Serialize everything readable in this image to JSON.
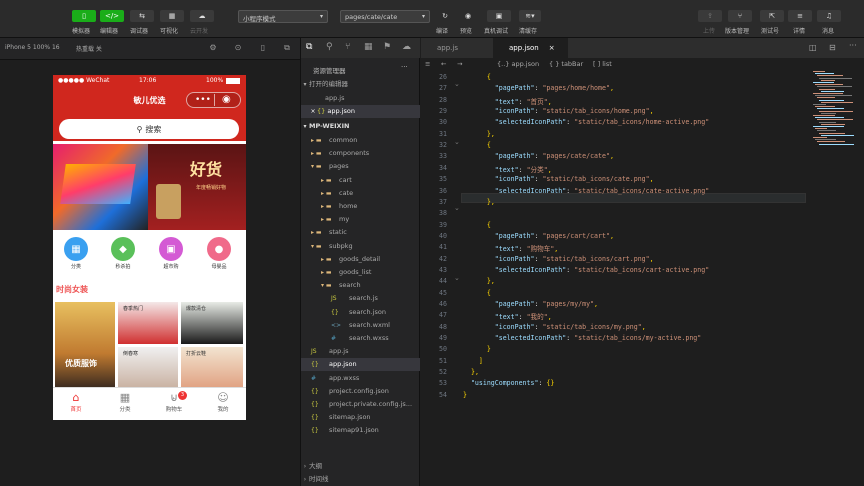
{
  "toolbar": {
    "left_buttons": [
      "模拟器",
      "编辑器",
      "调试器",
      "可视化",
      "云开发"
    ],
    "mode_select": "小程序模式",
    "page_select": "pages/cate/cate",
    "mid_buttons": [
      "编译",
      "预览",
      "真机调试",
      "清缓存"
    ],
    "right_buttons": [
      "上传",
      "版本管理",
      "测试号",
      "详情",
      "消息"
    ]
  },
  "simbar": {
    "device": "iPhone 5 100% 16",
    "hotreload": "热重载 关"
  },
  "phone": {
    "carrier": "●●●●● WeChat",
    "time": "17:06",
    "battery": "100%",
    "title": "敏儿优选",
    "search": "搜索",
    "banner_text": "好货",
    "banner_sub": "年度畅销好物",
    "cats": [
      "分类",
      "秒杀拍",
      "超市购",
      "母婴品"
    ],
    "floor_title": "时尚女装",
    "floor_tag1": "优质服饰",
    "floor_tag2": "春季热门",
    "floor_tag3": "爆款清仓",
    "floor_tag4": "倒春寒",
    "floor_tag5": "打折云鞋",
    "tabs": [
      "首页",
      "分类",
      "购物车",
      "我的"
    ],
    "cart_badge": "3"
  },
  "explorer": {
    "header": "资源管理器",
    "open_editors": "打开的编辑器",
    "open_files": [
      "app.js",
      "app.json"
    ],
    "project": "MP-WEIXIN",
    "tree": [
      {
        "name": "common",
        "depth": 1,
        "type": "folder"
      },
      {
        "name": "components",
        "depth": 1,
        "type": "folder"
      },
      {
        "name": "pages",
        "depth": 1,
        "type": "folder-open"
      },
      {
        "name": "cart",
        "depth": 2,
        "type": "folder"
      },
      {
        "name": "cate",
        "depth": 2,
        "type": "folder"
      },
      {
        "name": "home",
        "depth": 2,
        "type": "folder"
      },
      {
        "name": "my",
        "depth": 2,
        "type": "folder"
      },
      {
        "name": "static",
        "depth": 1,
        "type": "folder"
      },
      {
        "name": "subpkg",
        "depth": 1,
        "type": "folder-open"
      },
      {
        "name": "goods_detail",
        "depth": 2,
        "type": "folder"
      },
      {
        "name": "goods_list",
        "depth": 2,
        "type": "folder"
      },
      {
        "name": "search",
        "depth": 2,
        "type": "folder-open"
      },
      {
        "name": "search.js",
        "depth": 3,
        "type": "js"
      },
      {
        "name": "search.json",
        "depth": 3,
        "type": "json"
      },
      {
        "name": "search.wxml",
        "depth": 3,
        "type": "wxml"
      },
      {
        "name": "search.wxss",
        "depth": 3,
        "type": "wxss"
      },
      {
        "name": "app.js",
        "depth": 1,
        "type": "js"
      },
      {
        "name": "app.json",
        "depth": 1,
        "type": "json"
      },
      {
        "name": "app.wxss",
        "depth": 1,
        "type": "wxss"
      },
      {
        "name": "project.config.json",
        "depth": 1,
        "type": "json"
      },
      {
        "name": "project.private.config.js...",
        "depth": 1,
        "type": "json"
      },
      {
        "name": "sitemap.json",
        "depth": 1,
        "type": "json"
      },
      {
        "name": "sitemap91.json",
        "depth": 1,
        "type": "json"
      }
    ],
    "outline": "大纲",
    "timeline": "时间线"
  },
  "editor": {
    "tabs": [
      "app.js",
      "app.json"
    ],
    "breadcrumb": [
      "{..} app.json",
      "{ } tabBar",
      "[ ] list"
    ],
    "lines": [
      {
        "n": "26",
        "t": "      {"
      },
      {
        "n": "27",
        "t": "        \"pagePath\": \"pages/home/home\","
      },
      {
        "n": "28",
        "t": "        \"text\": \"首页\","
      },
      {
        "n": "29",
        "t": "        \"iconPath\": \"static/tab_icons/home.png\","
      },
      {
        "n": "30",
        "t": "        \"selectedIconPath\": \"static/tab_icons/home-active.png\""
      },
      {
        "n": "31",
        "t": "      },"
      },
      {
        "n": "32",
        "t": "      {"
      },
      {
        "n": "33",
        "t": "        \"pagePath\": \"pages/cate/cate\","
      },
      {
        "n": "34",
        "t": "        \"text\": \"分类\","
      },
      {
        "n": "35",
        "t": "        \"iconPath\": \"static/tab_icons/cate.png\","
      },
      {
        "n": "36",
        "t": "        \"selectedIconPath\": \"static/tab_icons/cate-active.png\""
      },
      {
        "n": "37",
        "t": "      },"
      },
      {
        "n": "38",
        "t": ""
      },
      {
        "n": "39",
        "t": "      {"
      },
      {
        "n": "40",
        "t": "        \"pagePath\": \"pages/cart/cart\","
      },
      {
        "n": "41",
        "t": "        \"text\": \"购物车\","
      },
      {
        "n": "42",
        "t": "        \"iconPath\": \"static/tab_icons/cart.png\","
      },
      {
        "n": "43",
        "t": "        \"selectedIconPath\": \"static/tab_icons/cart-active.png\""
      },
      {
        "n": "44",
        "t": "      },"
      },
      {
        "n": "45",
        "t": "      {"
      },
      {
        "n": "46",
        "t": "        \"pagePath\": \"pages/my/my\","
      },
      {
        "n": "47",
        "t": "        \"text\": \"我的\","
      },
      {
        "n": "48",
        "t": "        \"iconPath\": \"static/tab_icons/my.png\","
      },
      {
        "n": "49",
        "t": "        \"selectedIconPath\": \"static/tab_icons/my-active.png\""
      },
      {
        "n": "50",
        "t": "      }"
      },
      {
        "n": "51",
        "t": "    ]"
      },
      {
        "n": "52",
        "t": "  },"
      },
      {
        "n": "53",
        "t": "  \"usingComponents\": {}"
      },
      {
        "n": "54",
        "t": "}"
      }
    ]
  },
  "colors": {
    "accent": "#1aad19",
    "brand_red": "#d0271e",
    "key": "#9cdcfe",
    "string": "#ce9178"
  }
}
